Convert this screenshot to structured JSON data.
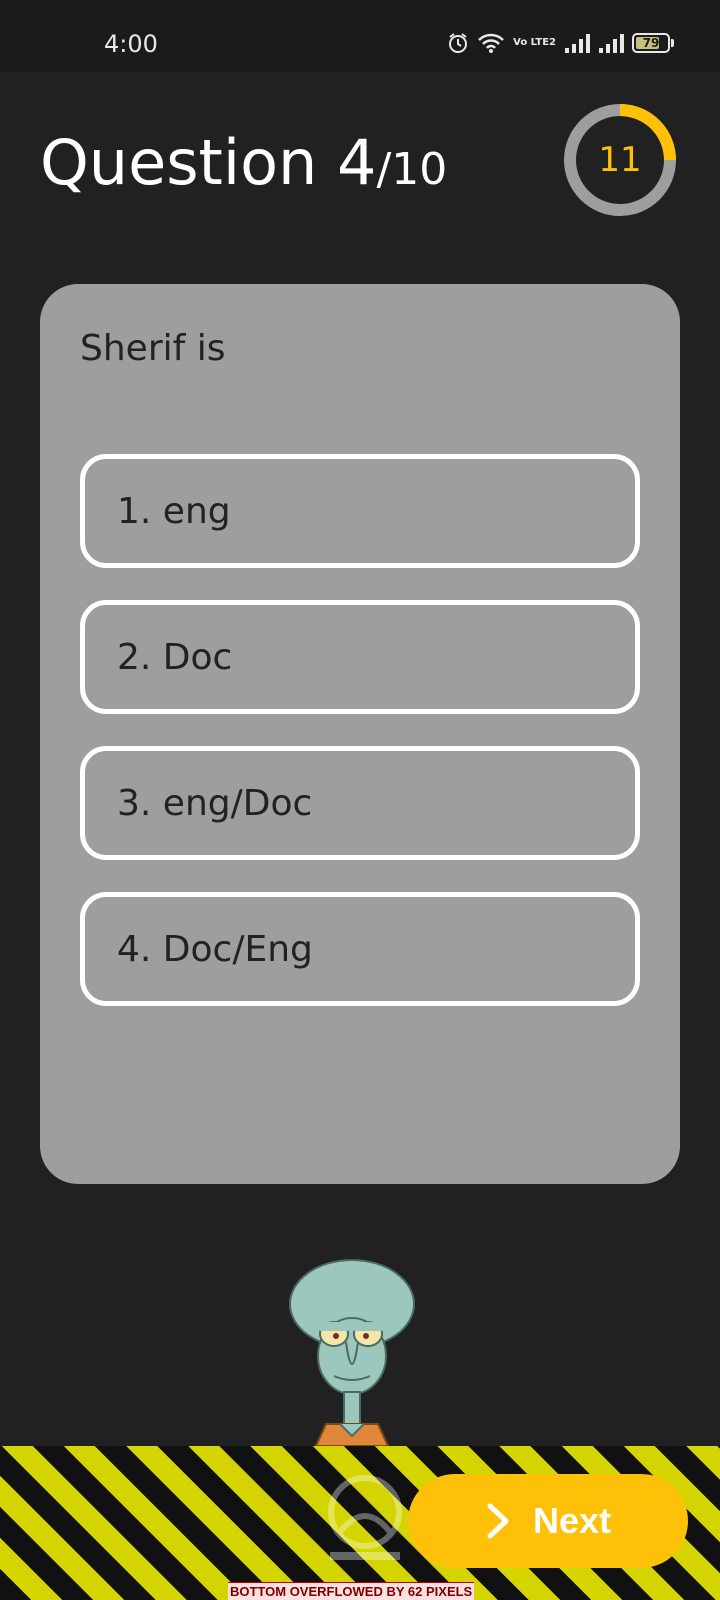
{
  "status_bar": {
    "time": "4:00",
    "network_label": "Vo LTE2",
    "battery_level": "79",
    "icons": [
      "alarm-icon",
      "wifi-icon",
      "volte-icon",
      "signal-icon",
      "signal-icon",
      "battery-icon"
    ]
  },
  "question": {
    "label": "Question 4",
    "total": "/10",
    "timer_value": "11",
    "timer_progress": 0.25,
    "text": "Sherif is"
  },
  "options": [
    {
      "label": "1. eng"
    },
    {
      "label": "2. Doc"
    },
    {
      "label": "3. eng/Doc"
    },
    {
      "label": "4. Doc/Eng"
    }
  ],
  "footer": {
    "next_label": "Next",
    "next_icon": "chevron-right-icon",
    "overflow_message": "BOTTOM OVERFLOWED BY 62 PIXELS"
  },
  "colors": {
    "background": "#212121",
    "card": "#9e9e9e",
    "accent": "#ffc107",
    "timer_track": "#9e9e9e",
    "hazard_yellow": "#d4d400"
  }
}
